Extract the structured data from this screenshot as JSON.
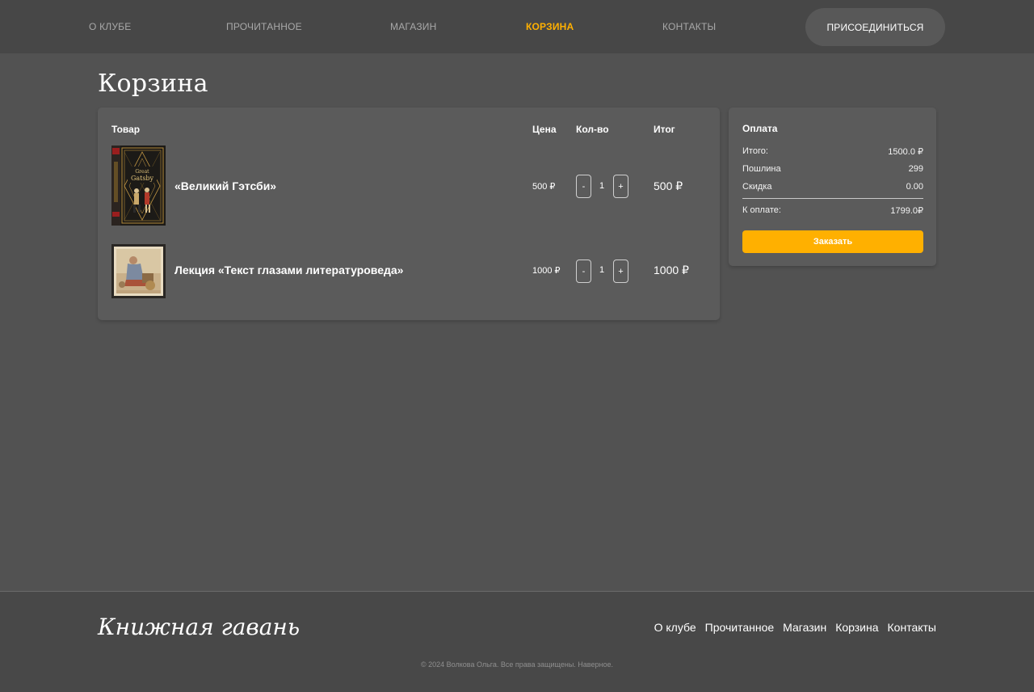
{
  "nav": {
    "items": [
      {
        "label": "О КЛУБЕ"
      },
      {
        "label": "ПРОЧИТАННОЕ"
      },
      {
        "label": "МАГАЗИН"
      },
      {
        "label": "КОРЗИНА"
      },
      {
        "label": "КОНТАКТЫ"
      }
    ],
    "join_label": "ПРИСОЕДИНИТЬСЯ"
  },
  "page": {
    "title": "Корзина"
  },
  "cart": {
    "headers": {
      "product": "Товар",
      "price": "Цена",
      "qty": "Кол-во",
      "total": "Итог"
    },
    "items": [
      {
        "name": "«Великий Гэтсби»",
        "price": "500 ₽",
        "qty": "1",
        "total": "500 ₽",
        "minus": "-",
        "plus": "+",
        "cover_title": "The Great Gatsby"
      },
      {
        "name": "Лекция «Текст глазами литературоведа»",
        "price": "1000 ₽",
        "qty": "1",
        "total": "1000 ₽",
        "minus": "-",
        "plus": "+"
      }
    ]
  },
  "payment": {
    "title": "Оплата",
    "subtotal_label": "Итого:",
    "subtotal_value": "1500.0 ₽",
    "duty_label": "Пошлина",
    "duty_value": "299",
    "discount_label": "Скидка",
    "discount_value": "0.00",
    "due_label": "К оплате:",
    "due_value": "1799.0₽",
    "order_label": "Заказать"
  },
  "footer": {
    "logo": "Книжная гавань",
    "links": [
      "О клубе",
      "Прочитанное",
      "Магазин",
      "Корзина",
      "Контакты"
    ],
    "copyright": "© 2024 Волкова Ольга. Все права защищены. Наверное."
  },
  "colors": {
    "accent": "#ffb000",
    "background": "#525252",
    "header": "#474747",
    "panel": "#5b5b5b"
  }
}
